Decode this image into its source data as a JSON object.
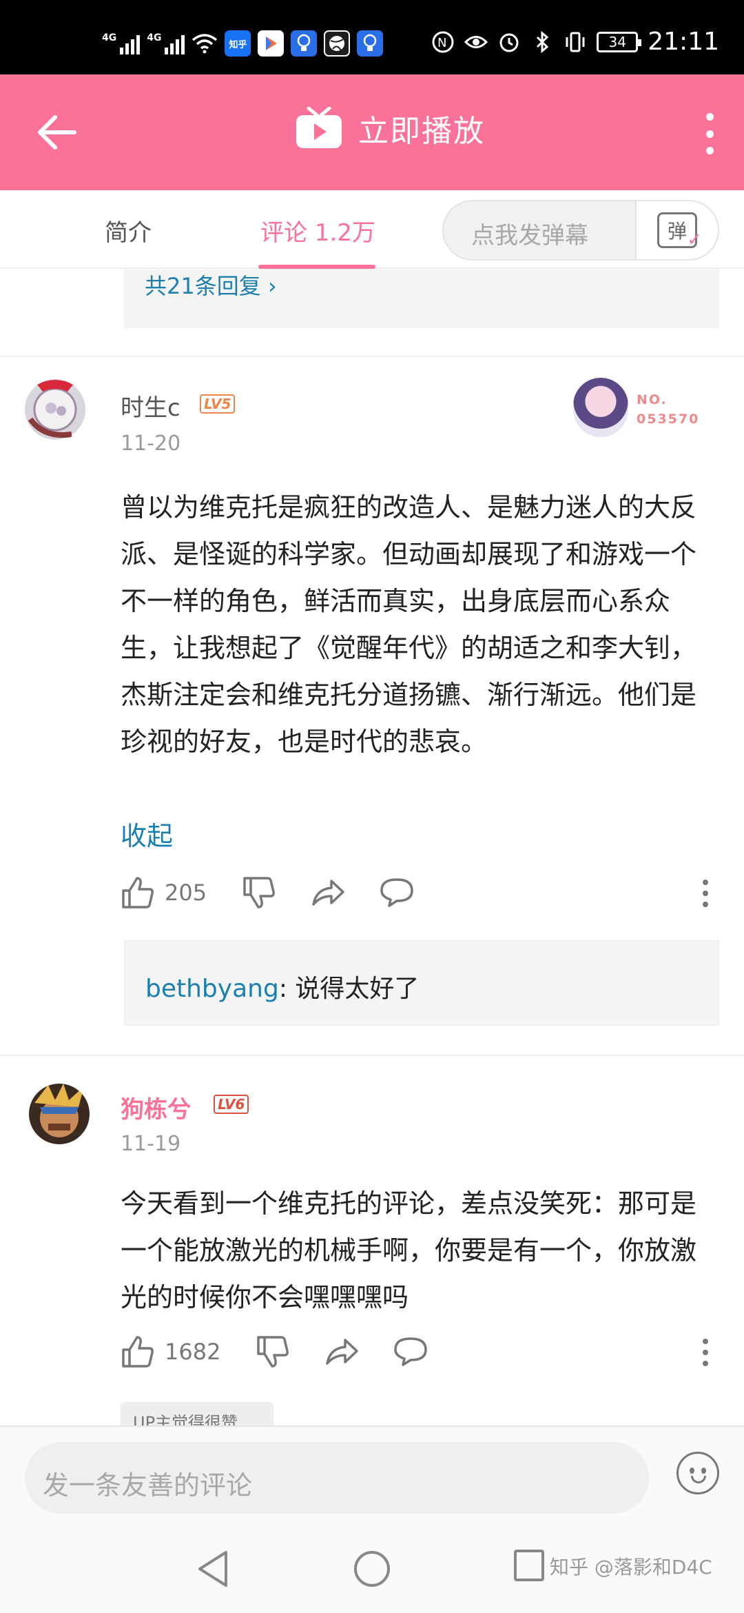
{
  "status_bar": {
    "time": "21:11",
    "battery": "34",
    "sim1": "4G",
    "sim2": "4G",
    "app_icon_zhihu": "知乎"
  },
  "top_bar": {
    "play_label": "立即播放"
  },
  "tabs": {
    "intro": "简介",
    "comment": "评论 1.2万",
    "danmaku_placeholder": "点我发弹幕",
    "danmaku_button": "弹"
  },
  "prev_comment": {
    "reply_count": "共21条回复 ›"
  },
  "comments": [
    {
      "username": "时生c",
      "level": "LV5",
      "date": "11-20",
      "fan_badge_no": "NO.",
      "fan_badge_num": "053570",
      "content": "曾以为维克托是疯狂的改造人、是魅力迷人的大反派、是怪诞的科学家。但动画却展现了和游戏一个不一样的角色，鲜活而真实，出身底层而心系众生，让我想起了《觉醒年代》的胡适之和李大钊，杰斯注定会和维克托分道扬镳、渐行渐远。他们是珍视的好友，也是时代的悲哀。",
      "collapse": "收起",
      "likes": "205",
      "sub_reply_user": "bethbyang",
      "sub_reply_text": ": 说得太好了"
    },
    {
      "username": "狗栋兮",
      "level": "LV6",
      "date": "11-19",
      "content": "今天看到一个维克托的评论，差点没笑死：那可是一个能放激光的机械手啊，你要是有一个，你放激光的时候你不会嘿嘿嘿吗",
      "likes": "1682",
      "tag": "UP主觉得很赞"
    }
  ],
  "bottom_bar": {
    "comment_placeholder": "发一条友善的评论"
  },
  "watermark": "知乎 @落影和D4C",
  "colors": {
    "brand_pink": "#fb7299",
    "link_blue": "#1a7fae",
    "level_orange": "#f0854a"
  }
}
